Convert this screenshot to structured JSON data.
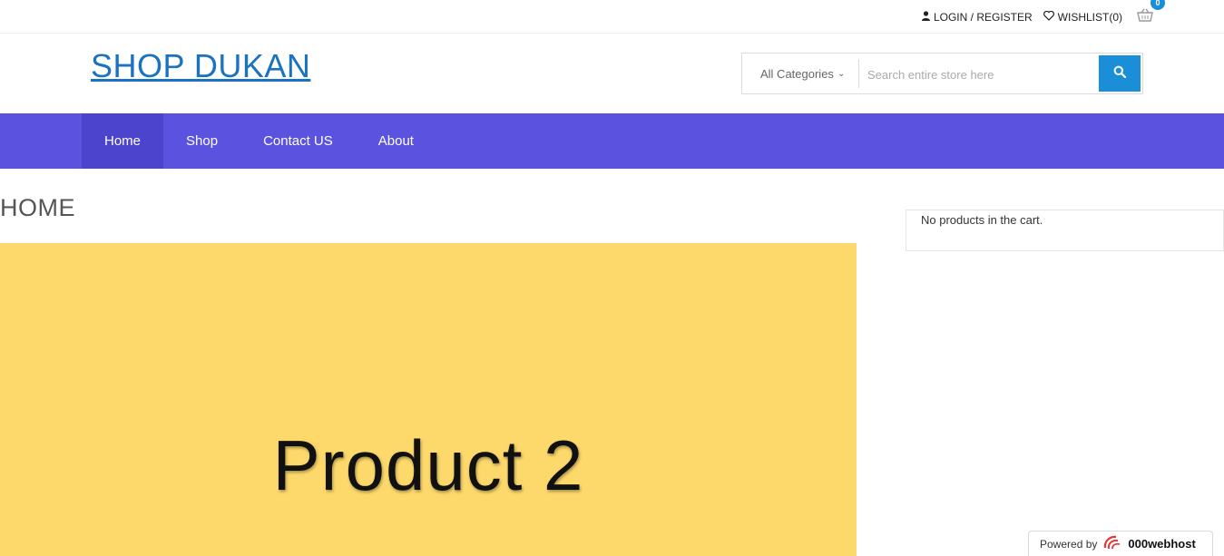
{
  "topbar": {
    "login_label": "LOGIN / REGISTER",
    "wishlist_label": "WISHLIST(0)",
    "cart_count": "0",
    "icons": {
      "login": "user-icon",
      "wishlist": "heart-icon",
      "cart": "basket-icon"
    }
  },
  "header": {
    "logo_text": "SHOP DUKAN",
    "category_select": "All Categories",
    "search_placeholder": "Search entire store here"
  },
  "nav": {
    "items": [
      {
        "label": "Home",
        "active": true
      },
      {
        "label": "Shop",
        "active": false
      },
      {
        "label": "Contact US",
        "active": false
      },
      {
        "label": "About",
        "active": false
      }
    ]
  },
  "main": {
    "page_title": "HOME",
    "banner_text": "Product 2"
  },
  "sidebar": {
    "cart_empty_text": "No products in the cart."
  },
  "footer_badge": {
    "powered_label": "Powered by",
    "brand": "000webhost"
  },
  "colors": {
    "nav_bg": "#5b53e0",
    "nav_active": "#4c44cc",
    "accent": "#1a8fd8",
    "logo": "#1a72c0",
    "banner_bg": "#fdd96c"
  }
}
